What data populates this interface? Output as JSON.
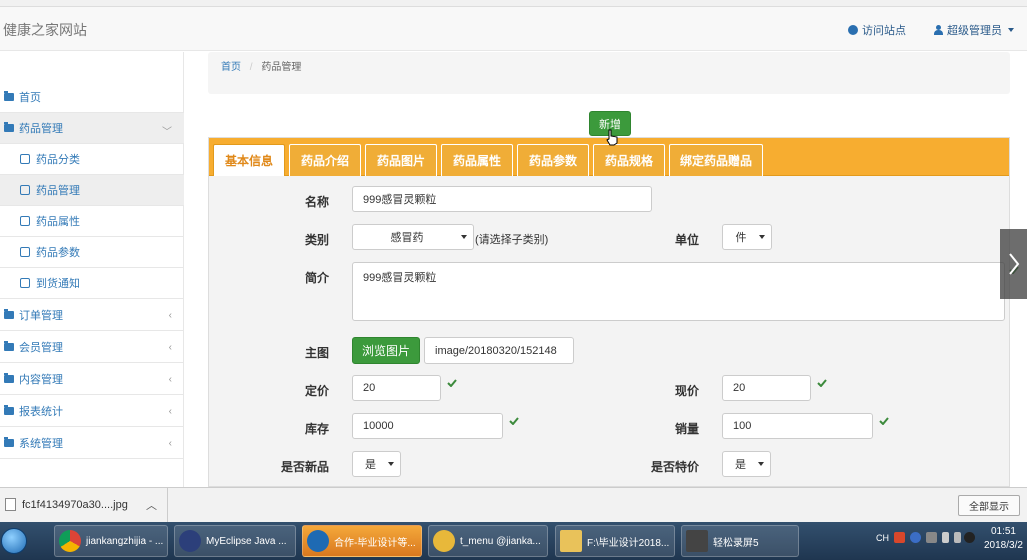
{
  "app": {
    "brand": "健康之家网站"
  },
  "navbar": {
    "visit_label": "访问站点",
    "admin_label": "超级管理员"
  },
  "sidebar": {
    "items": [
      {
        "label": "首页"
      },
      {
        "label": "药品管理"
      },
      {
        "label": "药品分类"
      },
      {
        "label": "药品管理"
      },
      {
        "label": "药品属性"
      },
      {
        "label": "药品参数"
      },
      {
        "label": "到货通知"
      },
      {
        "label": "订单管理"
      },
      {
        "label": "会员管理"
      },
      {
        "label": "内容管理"
      },
      {
        "label": "报表统计"
      },
      {
        "label": "系统管理"
      }
    ]
  },
  "breadcrumb": {
    "home": "首页",
    "separator": "/",
    "current": "药品管理"
  },
  "toolbar": {
    "add_label": "新增"
  },
  "tabs": [
    {
      "label": "基本信息"
    },
    {
      "label": "药品介绍"
    },
    {
      "label": "药品图片"
    },
    {
      "label": "药品属性"
    },
    {
      "label": "药品参数"
    },
    {
      "label": "药品规格"
    },
    {
      "label": "绑定药品赠品"
    }
  ],
  "form": {
    "name_label": "名称",
    "name_value": "999感冒灵颗粒",
    "category_label": "类别",
    "category_value": "感冒药",
    "category_hint": "(请选择子类别)",
    "unit_label": "单位",
    "unit_value": "件",
    "intro_label": "简介",
    "intro_value": "999感冒灵颗粒",
    "image_label": "主图",
    "browse_label": "浏览图片",
    "image_path": "image/20180320/152148",
    "price_label": "定价",
    "price_value": "20",
    "now_price_label": "现价",
    "now_price_value": "20",
    "stock_label": "库存",
    "stock_value": "10000",
    "sales_label": "销量",
    "sales_value": "100",
    "is_new_label": "是否新品",
    "is_new_value": "是",
    "is_special_label": "是否特价",
    "is_special_value": "是"
  },
  "download_bar": {
    "file_name": "fc1f4134970a30....jpg",
    "show_all_label": "全部显示"
  },
  "taskbar": {
    "tasks": [
      {
        "label": "jiankangzhijia - ..."
      },
      {
        "label": "MyEclipse Java ..."
      },
      {
        "label": "合作-毕业设计等..."
      },
      {
        "label": "t_menu @jianka..."
      },
      {
        "label": "F:\\毕业设计2018..."
      },
      {
        "label": "轻松录屏5"
      }
    ],
    "tray_lang": "CH",
    "clock_time": "01:51",
    "clock_date": "2018/3/2"
  },
  "colors": {
    "tab_bar": "#f7ad30",
    "tab_active_text": "#e0891a",
    "green_button": "#3c9a3c",
    "link_blue": "#337ab7",
    "check_green": "#3c8a3c"
  }
}
